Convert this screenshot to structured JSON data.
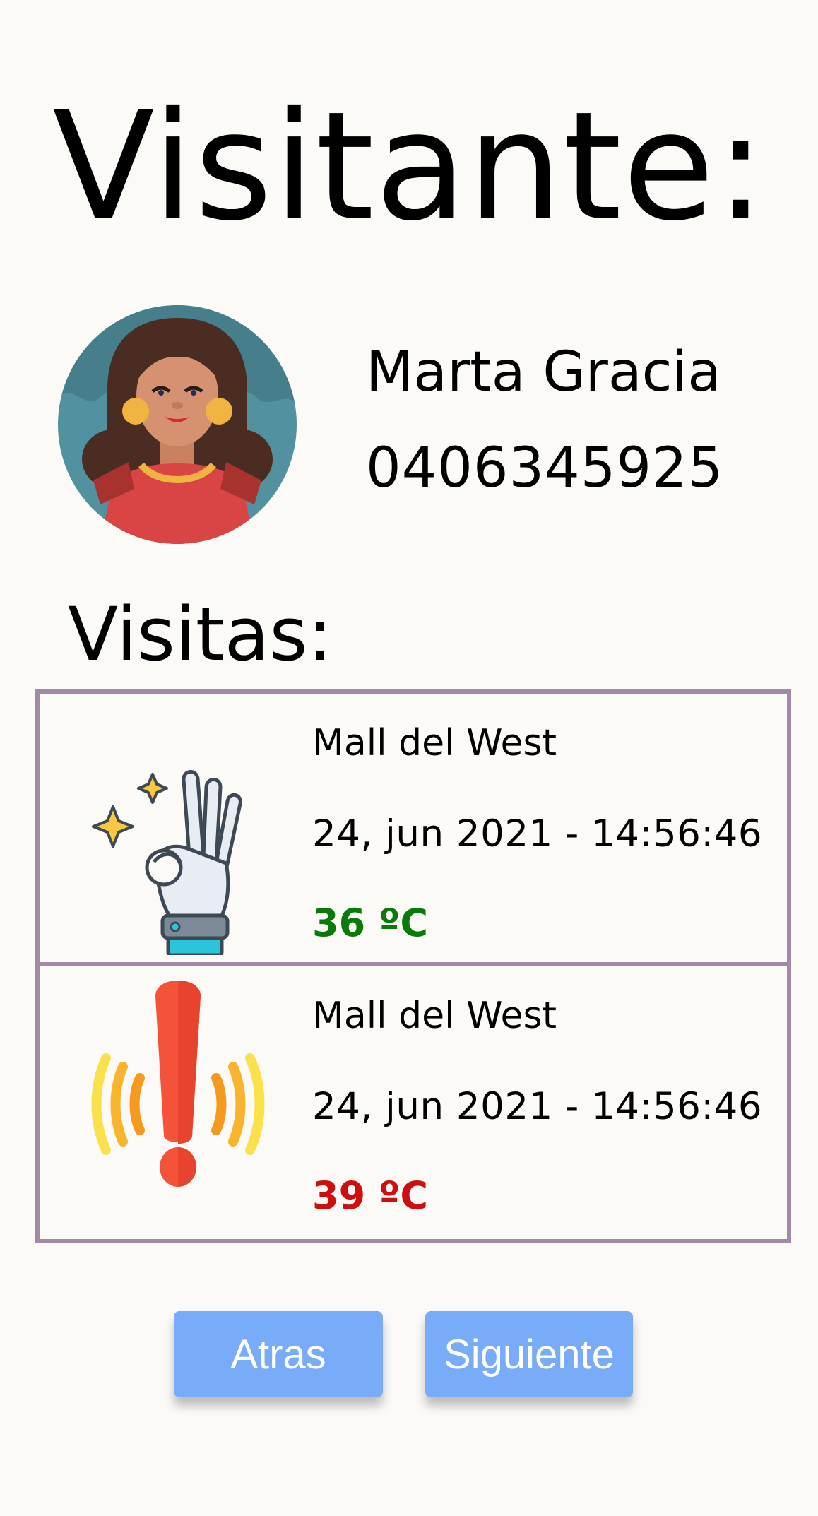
{
  "header": {
    "title": "Visitante:"
  },
  "visitor": {
    "avatar_icon": "woman-avatar-icon",
    "name": "Marta Gracia",
    "phone": "0406345925"
  },
  "visits": {
    "title": "Visitas:",
    "items": [
      {
        "icon": "ok-hand-icon",
        "place": "Mall del West",
        "datetime": "24, jun 2021 - 14:56:46",
        "temperature": "36 ºC",
        "temperature_color": "#0a7a0a"
      },
      {
        "icon": "alert-exclamation-icon",
        "place": "Mall del West",
        "datetime": "24, jun 2021 - 14:56:46",
        "temperature": "39 ºC",
        "temperature_color": "#cf0f0f"
      }
    ]
  },
  "buttons": {
    "back_label": "Atras",
    "next_label": "Siguiente"
  },
  "colors": {
    "background": "#fbfaf7",
    "table_border": "#a28aa6",
    "button": "#79acf8"
  }
}
